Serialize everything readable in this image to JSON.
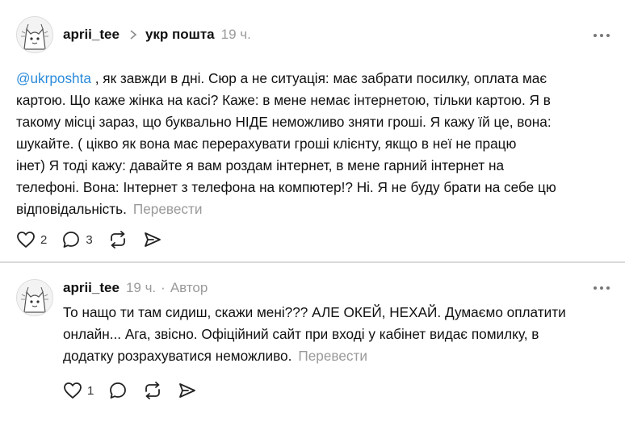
{
  "post1": {
    "username": "aprii_tee",
    "topic": "укр пошта",
    "time": "19 ч.",
    "mention": "@ukrposhta",
    "lines": [
      " , як завжди в дні. Сюр а не ситуація: має забрати посилку, оплата має",
      "картою. Що каже жінка на касі? Каже: в мене немає інтернетою, тільки картою. Я в",
      "такому місці зараз, що буквально НІДЕ неможливо зняти гроші. Я кажу їй це, вона:",
      "шукайте. ( цікво як вона має перерахувати гроші клієнту, якщо в неї не працю",
      "інет) Я тоді кажу: давайте я вам роздам інтернет, в мене гарний інтернет на",
      "телефоні. Вона: Інтернет з телефона на компютер!? Ні. Я не буду брати на себе цю",
      "відповідальність."
    ],
    "translate": "Перевести",
    "likes": "2",
    "replies": "3"
  },
  "post2": {
    "username": "aprii_tee",
    "time": "19 ч.",
    "dot": "·",
    "author": "Автор",
    "lines": [
      "То нащо ти там сидиш, скажи мені??? АЛЕ ОКЕЙ, НЕХАЙ. Думаємо оплатити",
      "онлайн... Ага, звісно. Офіційний сайт при вході у кабінет видає помилку, в",
      "додатку розрахуватися неможливо."
    ],
    "translate": "Перевести",
    "likes": "1"
  },
  "icons": [
    "heart-icon",
    "comment-icon",
    "repost-icon",
    "share-icon",
    "more-icon",
    "chevron-right-icon"
  ]
}
